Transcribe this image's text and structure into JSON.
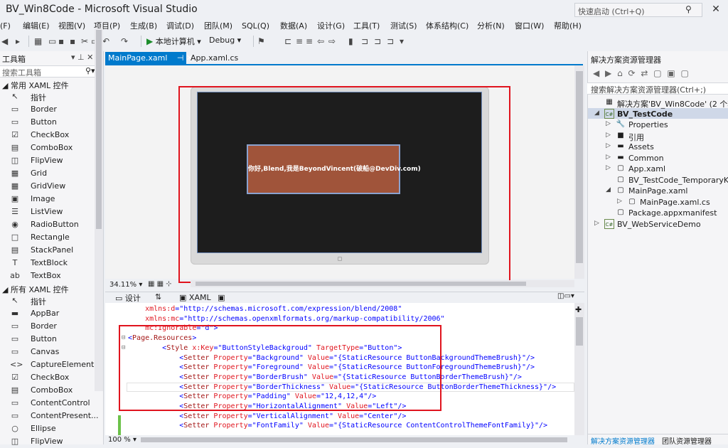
{
  "window": {
    "title": "BV_Win8Code - Microsoft Visual Studio",
    "quick_launch_placeholder": "快速启动 (Ctrl+Q)",
    "close_glyph": "✕"
  },
  "menu": [
    "(F)",
    "编辑(E)",
    "视图(V)",
    "项目(P)",
    "生成(B)",
    "调试(D)",
    "团队(M)",
    "SQL(Q)",
    "数据(A)",
    "设计(G)",
    "工具(T)",
    "测试(S)",
    "体系结构(C)",
    "分析(N)",
    "窗口(W)",
    "帮助(H)"
  ],
  "toolbar": {
    "run_target": "本地计算机",
    "configuration": "Debug"
  },
  "toolbox": {
    "title": "工具箱",
    "pin_glyphs": "▾ ⊥ ✕",
    "search_placeholder": "搜索工具箱",
    "group_common": "◢ 常用 XAML 控件",
    "group_all": "◢ 所有 XAML 控件",
    "common_items": [
      {
        "icon": "↖",
        "label": "指针"
      },
      {
        "icon": "▭",
        "label": "Border"
      },
      {
        "icon": "▭",
        "label": "Button"
      },
      {
        "icon": "☑",
        "label": "CheckBox"
      },
      {
        "icon": "▤",
        "label": "ComboBox"
      },
      {
        "icon": "◫",
        "label": "FlipView"
      },
      {
        "icon": "▦",
        "label": "Grid"
      },
      {
        "icon": "▦",
        "label": "GridView"
      },
      {
        "icon": "▣",
        "label": "Image"
      },
      {
        "icon": "☰",
        "label": "ListView"
      },
      {
        "icon": "◉",
        "label": "RadioButton"
      },
      {
        "icon": "□",
        "label": "Rectangle"
      },
      {
        "icon": "▤",
        "label": "StackPanel"
      },
      {
        "icon": "T",
        "label": "TextBlock"
      },
      {
        "icon": "ab",
        "label": "TextBox"
      }
    ],
    "all_items": [
      {
        "icon": "↖",
        "label": "指针"
      },
      {
        "icon": "▬",
        "label": "AppBar"
      },
      {
        "icon": "▭",
        "label": "Border"
      },
      {
        "icon": "▭",
        "label": "Button"
      },
      {
        "icon": "▭",
        "label": "Canvas"
      },
      {
        "icon": "<>",
        "label": "CaptureElement"
      },
      {
        "icon": "☑",
        "label": "CheckBox"
      },
      {
        "icon": "▤",
        "label": "ComboBox"
      },
      {
        "icon": "▭",
        "label": "ContentControl"
      },
      {
        "icon": "▭",
        "label": "ContentPresent..."
      },
      {
        "icon": "○",
        "label": "Ellipse"
      },
      {
        "icon": "◫",
        "label": "FlipView"
      }
    ]
  },
  "tabs": {
    "main": "MainPage.xaml",
    "main_icons": "⊣ ✕",
    "second": "App.xaml.cs"
  },
  "designer": {
    "button_text": "你好,Blend,我是BeyondVincent(破船@DevDiv.com)",
    "zoom": "34.11%",
    "zoom_arrow": "▾",
    "view_icons": "▦ ▦ ⊹"
  },
  "split": {
    "design_label": "设计",
    "swap_glyph": "⇅",
    "xaml_label": "XAML",
    "right_icons": "◫▭▾"
  },
  "code_lines": [
    {
      "indent": "    ",
      "parts": [
        [
          "attr",
          "xmlns:d"
        ],
        [
          "br",
          "=\""
        ],
        [
          "val",
          "http://schemas.microsoft.com/expression/blend/2008"
        ],
        [
          "br",
          "\""
        ]
      ]
    },
    {
      "indent": "    ",
      "parts": [
        [
          "attr",
          "xmlns:mc"
        ],
        [
          "br",
          "=\""
        ],
        [
          "val",
          "http://schemas.openxmlformats.org/markup-compatibility/2006"
        ],
        [
          "br",
          "\""
        ]
      ]
    },
    {
      "indent": "    ",
      "parts": [
        [
          "attr",
          "mc:Ignorable"
        ],
        [
          "br",
          "=\""
        ],
        [
          "val",
          "d"
        ],
        [
          "br",
          "\">"
        ]
      ]
    },
    {
      "indent": "",
      "parts": [
        [
          "br",
          "<"
        ],
        [
          "tag",
          "Page.Resources"
        ],
        [
          "br",
          ">"
        ]
      ]
    },
    {
      "indent": "        ",
      "parts": [
        [
          "br",
          "<"
        ],
        [
          "tag",
          "Style"
        ],
        [
          "attr",
          " x:Key"
        ],
        [
          "br",
          "=\""
        ],
        [
          "val",
          "ButtonStyleBackgroud"
        ],
        [
          "br",
          "\""
        ],
        [
          "attr",
          " TargetType"
        ],
        [
          "br",
          "=\""
        ],
        [
          "val",
          "Button"
        ],
        [
          "br",
          "\">"
        ]
      ]
    },
    {
      "indent": "            ",
      "parts": [
        [
          "br",
          "<"
        ],
        [
          "tag",
          "Setter"
        ],
        [
          "attr",
          " Property"
        ],
        [
          "br",
          "=\""
        ],
        [
          "val",
          "Background"
        ],
        [
          "br",
          "\""
        ],
        [
          "attr",
          " Value"
        ],
        [
          "br",
          "=\""
        ],
        [
          "val",
          "{StaticResource ButtonBackgroundThemeBrush}"
        ],
        [
          "br",
          "\"/>"
        ]
      ]
    },
    {
      "indent": "            ",
      "parts": [
        [
          "br",
          "<"
        ],
        [
          "tag",
          "Setter"
        ],
        [
          "attr",
          " Property"
        ],
        [
          "br",
          "=\""
        ],
        [
          "val",
          "Foreground"
        ],
        [
          "br",
          "\""
        ],
        [
          "attr",
          " Value"
        ],
        [
          "br",
          "=\""
        ],
        [
          "val",
          "{StaticResource ButtonForegroundThemeBrush}"
        ],
        [
          "br",
          "\"/>"
        ]
      ]
    },
    {
      "indent": "            ",
      "parts": [
        [
          "br",
          "<"
        ],
        [
          "tag",
          "Setter"
        ],
        [
          "attr",
          " Property"
        ],
        [
          "br",
          "=\""
        ],
        [
          "val",
          "BorderBrush"
        ],
        [
          "br",
          "\""
        ],
        [
          "attr",
          " Value"
        ],
        [
          "br",
          "=\""
        ],
        [
          "val",
          "{StaticResource ButtonBorderThemeBrush}"
        ],
        [
          "br",
          "\"/>"
        ]
      ]
    },
    {
      "indent": "            ",
      "parts": [
        [
          "br",
          "<"
        ],
        [
          "tag",
          "Setter"
        ],
        [
          "attr",
          " Property"
        ],
        [
          "br",
          "=\""
        ],
        [
          "val",
          "BorderThickness"
        ],
        [
          "br",
          "\""
        ],
        [
          "attr",
          " Value"
        ],
        [
          "br",
          "=\""
        ],
        [
          "val",
          "{StaticResource ButtonBorderThemeThickness}"
        ],
        [
          "br",
          "\"/>"
        ]
      ]
    },
    {
      "indent": "            ",
      "parts": [
        [
          "br",
          "<"
        ],
        [
          "tag",
          "Setter"
        ],
        [
          "attr",
          " Property"
        ],
        [
          "br",
          "=\""
        ],
        [
          "val",
          "Padding"
        ],
        [
          "br",
          "\""
        ],
        [
          "attr",
          " Value"
        ],
        [
          "br",
          "=\""
        ],
        [
          "val",
          "12,4,12,4"
        ],
        [
          "br",
          "\"/>"
        ]
      ]
    },
    {
      "indent": "            ",
      "parts": [
        [
          "br",
          "<"
        ],
        [
          "tag",
          "Setter"
        ],
        [
          "attr",
          " Property"
        ],
        [
          "br",
          "=\""
        ],
        [
          "val",
          "HorizontalAlignment"
        ],
        [
          "br",
          "\""
        ],
        [
          "attr",
          " Value"
        ],
        [
          "br",
          "=\""
        ],
        [
          "val",
          "Left"
        ],
        [
          "br",
          "\"/>"
        ]
      ]
    },
    {
      "indent": "            ",
      "parts": [
        [
          "br",
          "<"
        ],
        [
          "tag",
          "Setter"
        ],
        [
          "attr",
          " Property"
        ],
        [
          "br",
          "=\""
        ],
        [
          "val",
          "VerticalAlignment"
        ],
        [
          "br",
          "\""
        ],
        [
          "attr",
          " Value"
        ],
        [
          "br",
          "=\""
        ],
        [
          "val",
          "Center"
        ],
        [
          "br",
          "\"/>"
        ]
      ]
    },
    {
      "indent": "            ",
      "parts": [
        [
          "br",
          "<"
        ],
        [
          "tag",
          "Setter"
        ],
        [
          "attr",
          " Property"
        ],
        [
          "br",
          "=\""
        ],
        [
          "val",
          "FontFamily"
        ],
        [
          "br",
          "\""
        ],
        [
          "attr",
          " Value"
        ],
        [
          "br",
          "=\""
        ],
        [
          "val",
          "{StaticResource ContentControlThemeFontFamily}"
        ],
        [
          "br",
          "\"/>"
        ]
      ]
    }
  ],
  "editor": {
    "zoom": "100 %"
  },
  "solution": {
    "title": "解决方案资源管理器",
    "toolbar_glyphs": "◀ ▶ ⌂ ⟳ ⇄ ▢ ▣ ▢",
    "search_placeholder": "搜索解决方案资源管理器(Ctrl+;)",
    "tree": [
      {
        "depth": 0,
        "arrow": "",
        "icon": "▦",
        "label": "解决方案'BV_Win8Code' (2 个项目)",
        "bold": false
      },
      {
        "depth": 0,
        "arrow": "◢",
        "icon": "C#",
        "label": "BV_TestCode",
        "bold": true
      },
      {
        "depth": 1,
        "arrow": "▷",
        "icon": "🔧",
        "label": "Properties",
        "bold": false
      },
      {
        "depth": 1,
        "arrow": "▷",
        "icon": "■",
        "label": "引用",
        "bold": false
      },
      {
        "depth": 1,
        "arrow": "▷",
        "icon": "▬",
        "label": "Assets",
        "bold": false
      },
      {
        "depth": 1,
        "arrow": "▷",
        "icon": "▬",
        "label": "Common",
        "bold": false
      },
      {
        "depth": 1,
        "arrow": "▷",
        "icon": "▢",
        "label": "App.xaml",
        "bold": false
      },
      {
        "depth": 1,
        "arrow": "",
        "icon": "▢",
        "label": "BV_TestCode_TemporaryKey",
        "bold": false
      },
      {
        "depth": 1,
        "arrow": "◢",
        "icon": "▢",
        "label": "MainPage.xaml",
        "bold": false
      },
      {
        "depth": 2,
        "arrow": "▷",
        "icon": "▢",
        "label": "MainPage.xaml.cs",
        "bold": false
      },
      {
        "depth": 1,
        "arrow": "",
        "icon": "▢",
        "label": "Package.appxmanifest",
        "bold": false
      },
      {
        "depth": 0,
        "arrow": "▷",
        "icon": "C#",
        "label": "BV_WebServiceDemo",
        "bold": false
      }
    ],
    "bottom_tab_1": "解决方案资源管理器",
    "bottom_tab_2": "团队资源管理器"
  }
}
